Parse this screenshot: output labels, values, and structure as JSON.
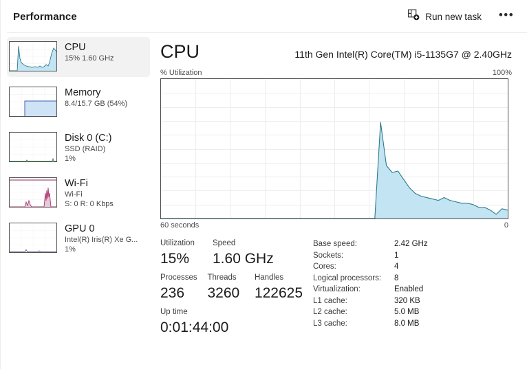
{
  "header": {
    "title": "Performance",
    "run_new_task_label": "Run new task",
    "run_new_task_icon": "new-task-icon",
    "more_label": "•••",
    "more_icon": "ellipsis-icon"
  },
  "sidebar": {
    "items": [
      {
        "name": "CPU",
        "sub1": "15%  1.60 GHz",
        "sub2": "",
        "selected": true,
        "thumb": "cpu-thumb-graph"
      },
      {
        "name": "Memory",
        "sub1": "8.4/15.7 GB (54%)",
        "sub2": "",
        "selected": false,
        "thumb": "memory-thumb-graph"
      },
      {
        "name": "Disk 0 (C:)",
        "sub1": "SSD (RAID)",
        "sub2": "1%",
        "selected": false,
        "thumb": "disk-thumb-graph"
      },
      {
        "name": "Wi-Fi",
        "sub1": "Wi-Fi",
        "sub2": "S: 0 R: 0 Kbps",
        "selected": false,
        "thumb": "wifi-thumb-graph"
      },
      {
        "name": "GPU 0",
        "sub1": "Intel(R) Iris(R) Xe G...",
        "sub2": "1%",
        "selected": false,
        "thumb": "gpu-thumb-graph"
      }
    ]
  },
  "main": {
    "title": "CPU",
    "subtitle": "11th Gen Intel(R) Core(TM) i5-1135G7 @ 2.40GHz",
    "axis_left_label": "% Utilization",
    "axis_right_label": "100%",
    "time_left_label": "60 seconds",
    "time_right_label": "0",
    "stats": [
      {
        "label": "Utilization",
        "value": "15%"
      },
      {
        "label": "Speed",
        "value": "1.60 GHz"
      },
      {
        "label": "Processes",
        "value": "236"
      },
      {
        "label": "Threads",
        "value": "3260"
      },
      {
        "label": "Handles",
        "value": "122625"
      },
      {
        "label": "Up time",
        "value": "0:01:44:00"
      }
    ],
    "specs": [
      {
        "key": "Base speed:",
        "value": "2.42 GHz"
      },
      {
        "key": "Sockets:",
        "value": "1"
      },
      {
        "key": "Cores:",
        "value": "4"
      },
      {
        "key": "Logical processors:",
        "value": "8"
      },
      {
        "key": "Virtualization:",
        "value": "Enabled"
      },
      {
        "key": "L1 cache:",
        "value": "320 KB"
      },
      {
        "key": "L2 cache:",
        "value": "5.0 MB"
      },
      {
        "key": "L3 cache:",
        "value": "8.0 MB"
      }
    ]
  },
  "colors": {
    "graph_line": "#2c7a8c",
    "graph_fill": "#c3e4f2",
    "grid": "#ededed",
    "graph_border": "#4a4a4a",
    "selection": "#f2f2f2",
    "wifi_line": "#a8336e"
  },
  "chart_data": {
    "type": "area",
    "title": "CPU % Utilization",
    "xlabel": "60 seconds",
    "ylabel": "% Utilization",
    "ylim": [
      0,
      100
    ],
    "xlim": [
      60,
      0
    ],
    "grid": true,
    "legend": null,
    "x": [
      0,
      1,
      2,
      3,
      4,
      5,
      6,
      7,
      8,
      9,
      10,
      11,
      12,
      13,
      14,
      15,
      16,
      17,
      18,
      19,
      20,
      21,
      22,
      23,
      24,
      25,
      26,
      27,
      28,
      29,
      30,
      31,
      32,
      33,
      34,
      35,
      36,
      37,
      38,
      39,
      40,
      41,
      42,
      43,
      44,
      45,
      46,
      47,
      48,
      49,
      50,
      51,
      52,
      53,
      54,
      55,
      56,
      57,
      58,
      59,
      60
    ],
    "values": [
      0,
      0,
      0,
      0,
      0,
      0,
      0,
      0,
      0,
      0,
      0,
      0,
      0,
      0,
      0,
      0,
      0,
      0,
      0,
      0,
      0,
      0,
      0,
      0,
      0,
      0,
      0,
      0,
      0,
      0,
      0,
      0,
      0,
      0,
      0,
      0,
      0,
      0,
      69,
      38,
      33,
      34,
      28,
      22,
      18,
      16,
      15,
      14,
      13,
      15,
      13,
      12,
      11,
      11,
      10,
      8,
      8,
      6,
      3,
      7,
      6
    ]
  }
}
